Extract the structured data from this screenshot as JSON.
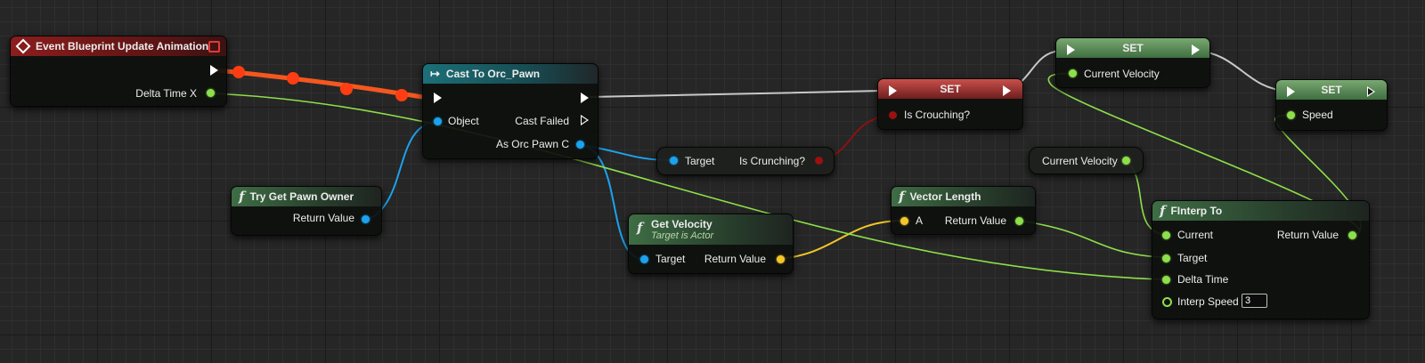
{
  "colors": {
    "exec": "#ffffff",
    "float": "#8de04a",
    "object": "#1aa3ee",
    "vector": "#f1c62a",
    "boolean": "#9c1010",
    "event_header": "#8c1d1d",
    "cast_header": "#1c6f78",
    "function_header": "#3e6d44"
  },
  "icons": {
    "event": "diamond-icon",
    "cast": "cast-arrow-icon",
    "function": "function-f-icon",
    "exec": "exec-arrow-icon",
    "stop": "stop-square-icon"
  },
  "nodes": {
    "event": {
      "title": "Event Blueprint Update Animation",
      "delta_time": "Delta Time X"
    },
    "cast": {
      "title": "Cast To Orc_Pawn",
      "object": "Object",
      "cast_failed": "Cast Failed",
      "as_pawn": "As Orc Pawn C"
    },
    "pawn_owner": {
      "title": "Try Get Pawn Owner",
      "return_value": "Return Value",
      "glyph": "f"
    },
    "get_crunching": {
      "target": "Target",
      "output": "Is Crunching?"
    },
    "set_crouching": {
      "title": "SET",
      "input": "Is Crouching?"
    },
    "set_velocity": {
      "title": "SET",
      "input": "Current Velocity"
    },
    "set_speed": {
      "title": "SET",
      "input": "Speed"
    },
    "get_velocity": {
      "title": "Get Velocity",
      "subtitle": "Target is Actor",
      "target": "Target",
      "return_value": "Return Value",
      "glyph": "f"
    },
    "vector_length": {
      "title": "Vector Length",
      "a": "A",
      "return_value": "Return Value",
      "glyph": "f"
    },
    "current_velocity_get": {
      "label": "Current Velocity"
    },
    "finterp": {
      "title": "FInterp To",
      "current": "Current",
      "target": "Target",
      "delta_time": "Delta Time",
      "interp_speed": "Interp Speed",
      "interp_speed_value": "3",
      "return_value": "Return Value",
      "glyph": "f"
    }
  }
}
